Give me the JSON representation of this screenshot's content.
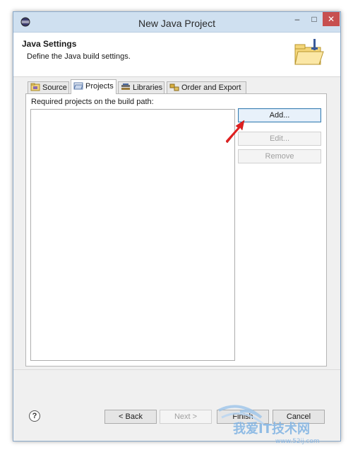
{
  "window": {
    "title": "New Java Project"
  },
  "header": {
    "title": "Java Settings",
    "description": "Define the Java build settings."
  },
  "tabs": [
    {
      "label": "Source",
      "icon": "source-folder-icon"
    },
    {
      "label": "Projects",
      "icon": "projects-folder-icon",
      "active": true
    },
    {
      "label": "Libraries",
      "icon": "libraries-icon"
    },
    {
      "label": "Order and Export",
      "icon": "order-export-icon"
    }
  ],
  "projects_panel": {
    "label": "Required projects on the build path:",
    "items": []
  },
  "side_buttons": {
    "add": "Add...",
    "edit": "Edit...",
    "remove": "Remove"
  },
  "footer": {
    "help": "?",
    "back": "< Back",
    "next": "Next >",
    "finish": "Finish",
    "cancel": "Cancel"
  },
  "watermark": {
    "text": "我爱IT技术网",
    "url": "www.52ij.com"
  },
  "colors": {
    "titlebar": "#cfe0f0",
    "close_button": "#c75050",
    "arrow": "#e02020",
    "focus_border": "#3c7fb1"
  }
}
